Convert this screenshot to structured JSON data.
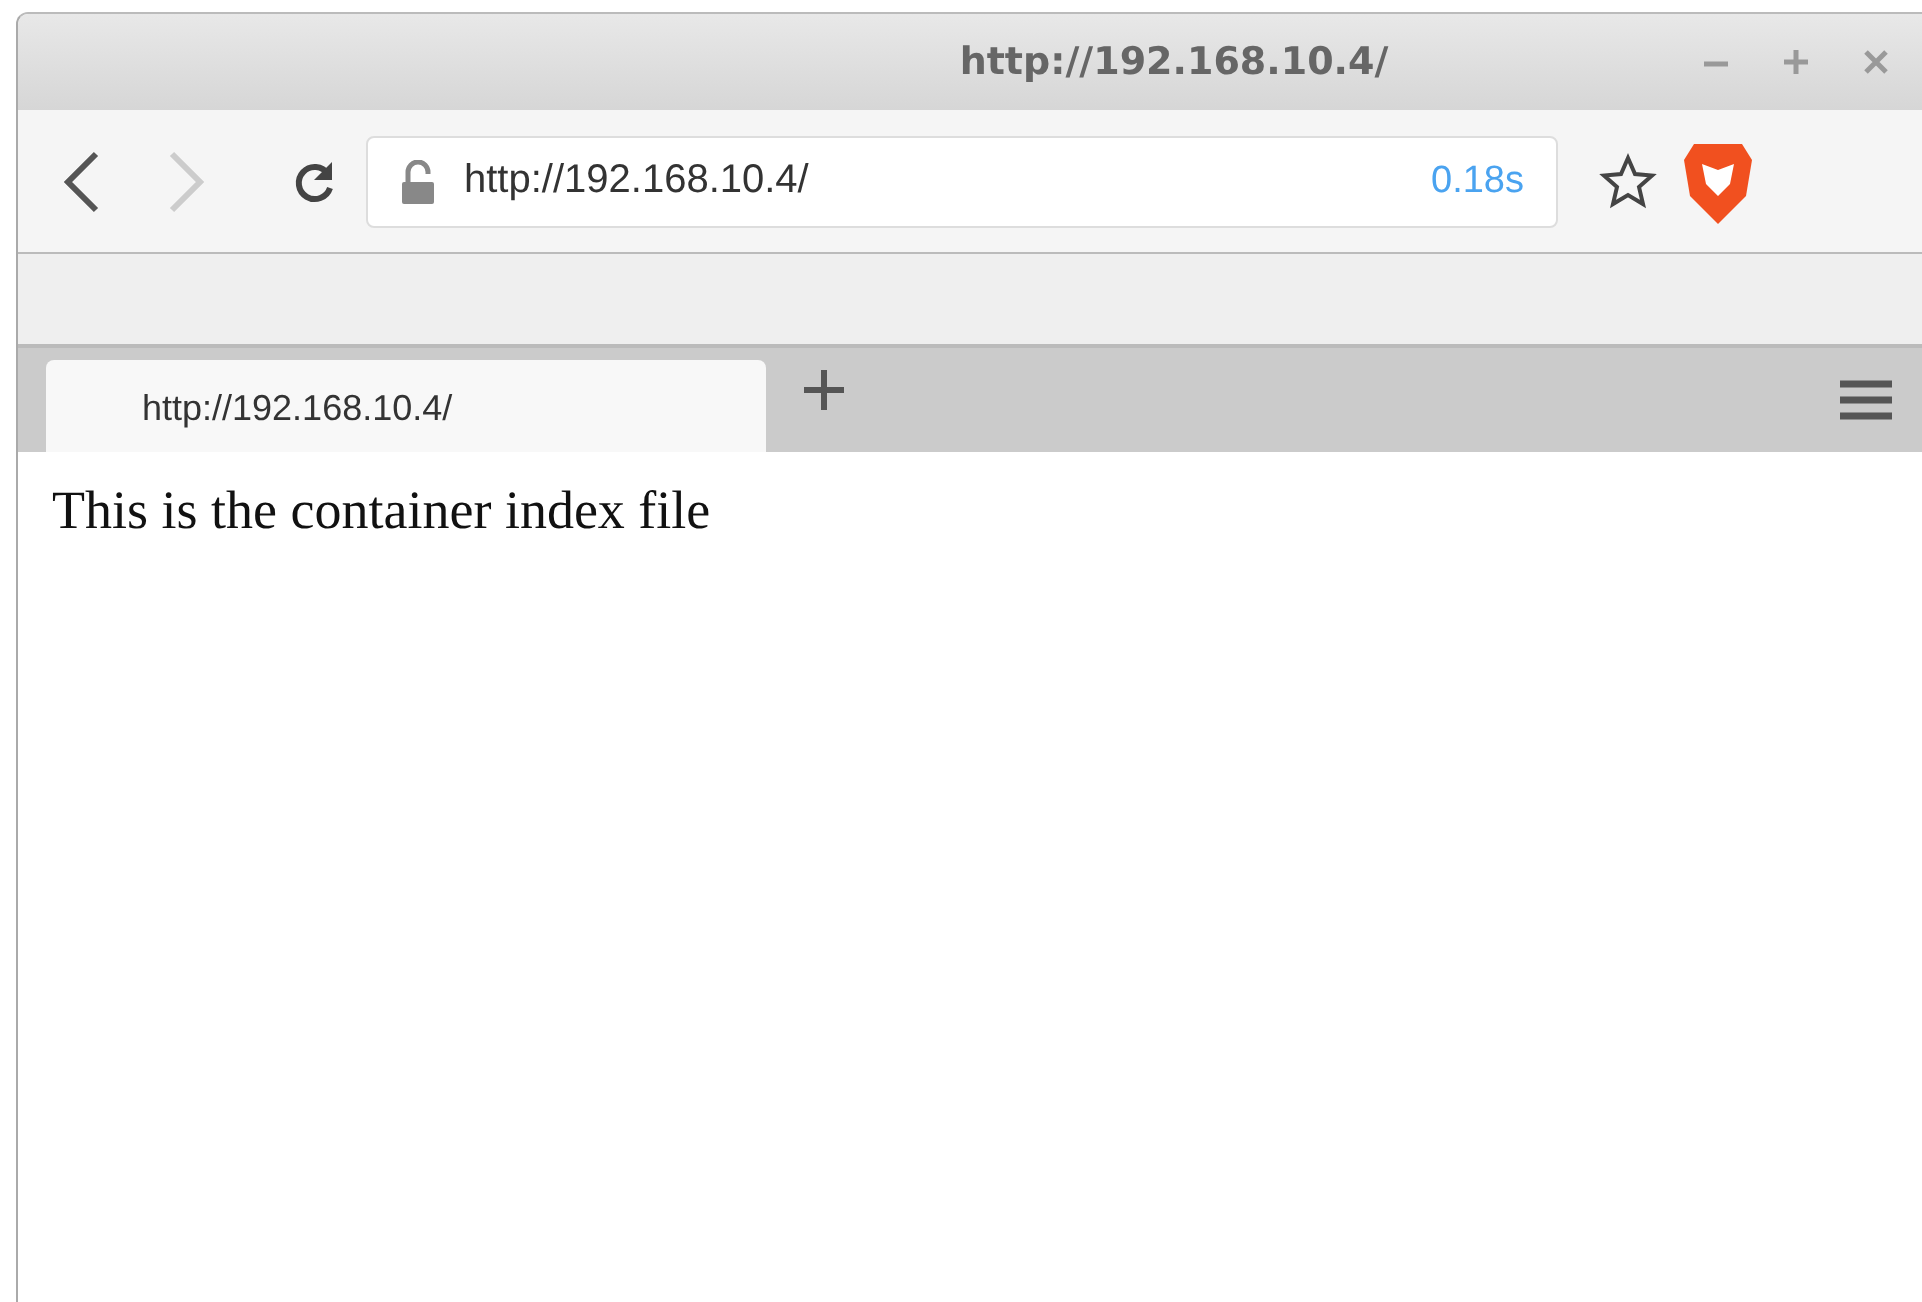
{
  "window": {
    "title": "http://192.168.10.4/"
  },
  "toolbar": {
    "back": {
      "disabled": false
    },
    "forward": {
      "disabled": true
    },
    "address": {
      "value": "http://192.168.10.4/",
      "load_time": "0.18s"
    }
  },
  "tabs": [
    {
      "label": "http://192.168.10.4/",
      "selected": true
    }
  ],
  "page": {
    "text": "This is the container index file"
  }
}
